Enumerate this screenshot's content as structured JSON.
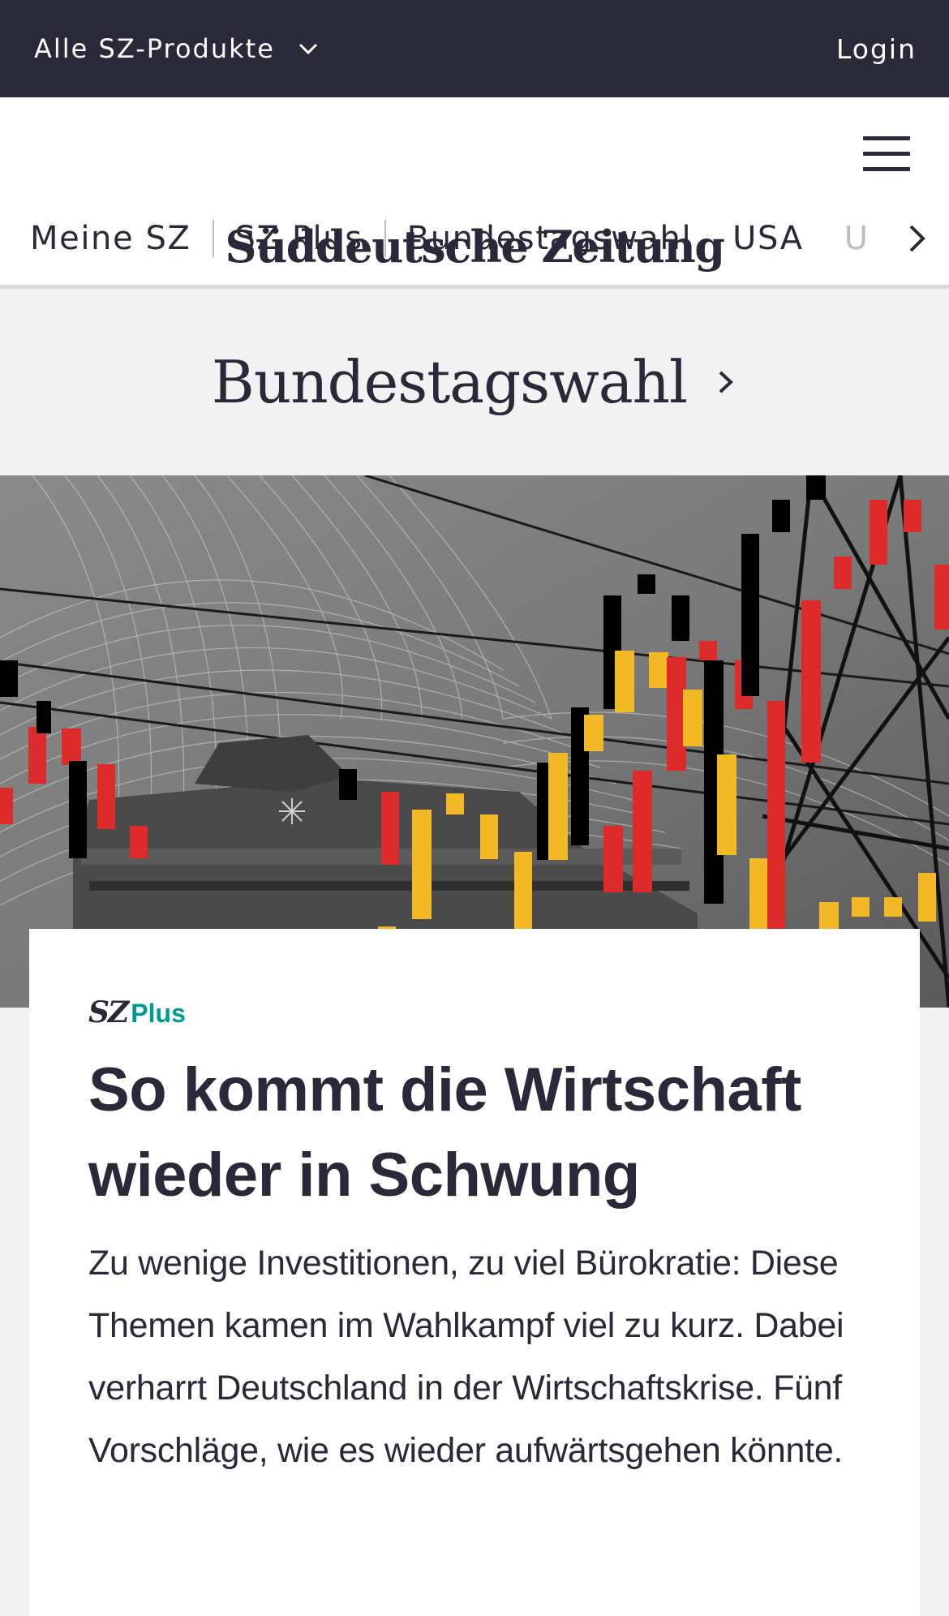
{
  "topbar": {
    "products_label": "Alle SZ-Produkte",
    "login_label": "Login"
  },
  "header": {
    "logo_text": "Süddeutsche Zeitung",
    "nav_items": [
      "Meine SZ",
      "SZ Plus",
      "Bundestagswahl",
      "USA",
      "U"
    ]
  },
  "section": {
    "title": "Bundestagswahl"
  },
  "article": {
    "badge_sz": "SZ",
    "badge_plus": "Plus",
    "headline": "So kommt die Wirtschaft wieder in Schwung",
    "teaser": "Zu wenige Investitionen, zu viel Bürokratie: Diese Themen kamen im Wahlkampf viel zu kurz. Dabei verharrt Deutschland in der Wirtschaftskrise. Fünf Vorschläge, wie es wieder aufwärtsgehen könnte."
  },
  "colors": {
    "dark": "#29293a",
    "accent_plus": "#009a93",
    "flag_black": "#000000",
    "flag_red": "#dd2a2a",
    "flag_gold": "#f2b825"
  }
}
